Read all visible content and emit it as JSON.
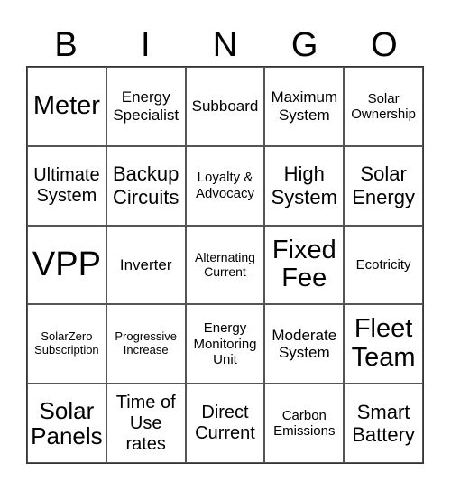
{
  "header": {
    "letters": [
      "B",
      "I",
      "N",
      "G",
      "O"
    ]
  },
  "grid": {
    "rows": [
      [
        "Meter",
        "Energy Specialist",
        "Subboard",
        "Maximum System",
        "Solar Ownership"
      ],
      [
        "Ultimate System",
        "Backup Circuits",
        "Loyalty & Advocacy",
        "High System",
        "Solar Energy"
      ],
      [
        "VPP",
        "Inverter",
        "Alternating Current",
        "Fixed Fee",
        "Ecotricity"
      ],
      [
        "SolarZero Subscription",
        "Progressive Increase",
        "Energy Monitoring Unit",
        "Moderate System",
        "Fleet Team"
      ],
      [
        "Solar Panels",
        "Time of Use rates",
        "Direct Current",
        "Carbon Emissions",
        "Smart Battery"
      ]
    ]
  }
}
